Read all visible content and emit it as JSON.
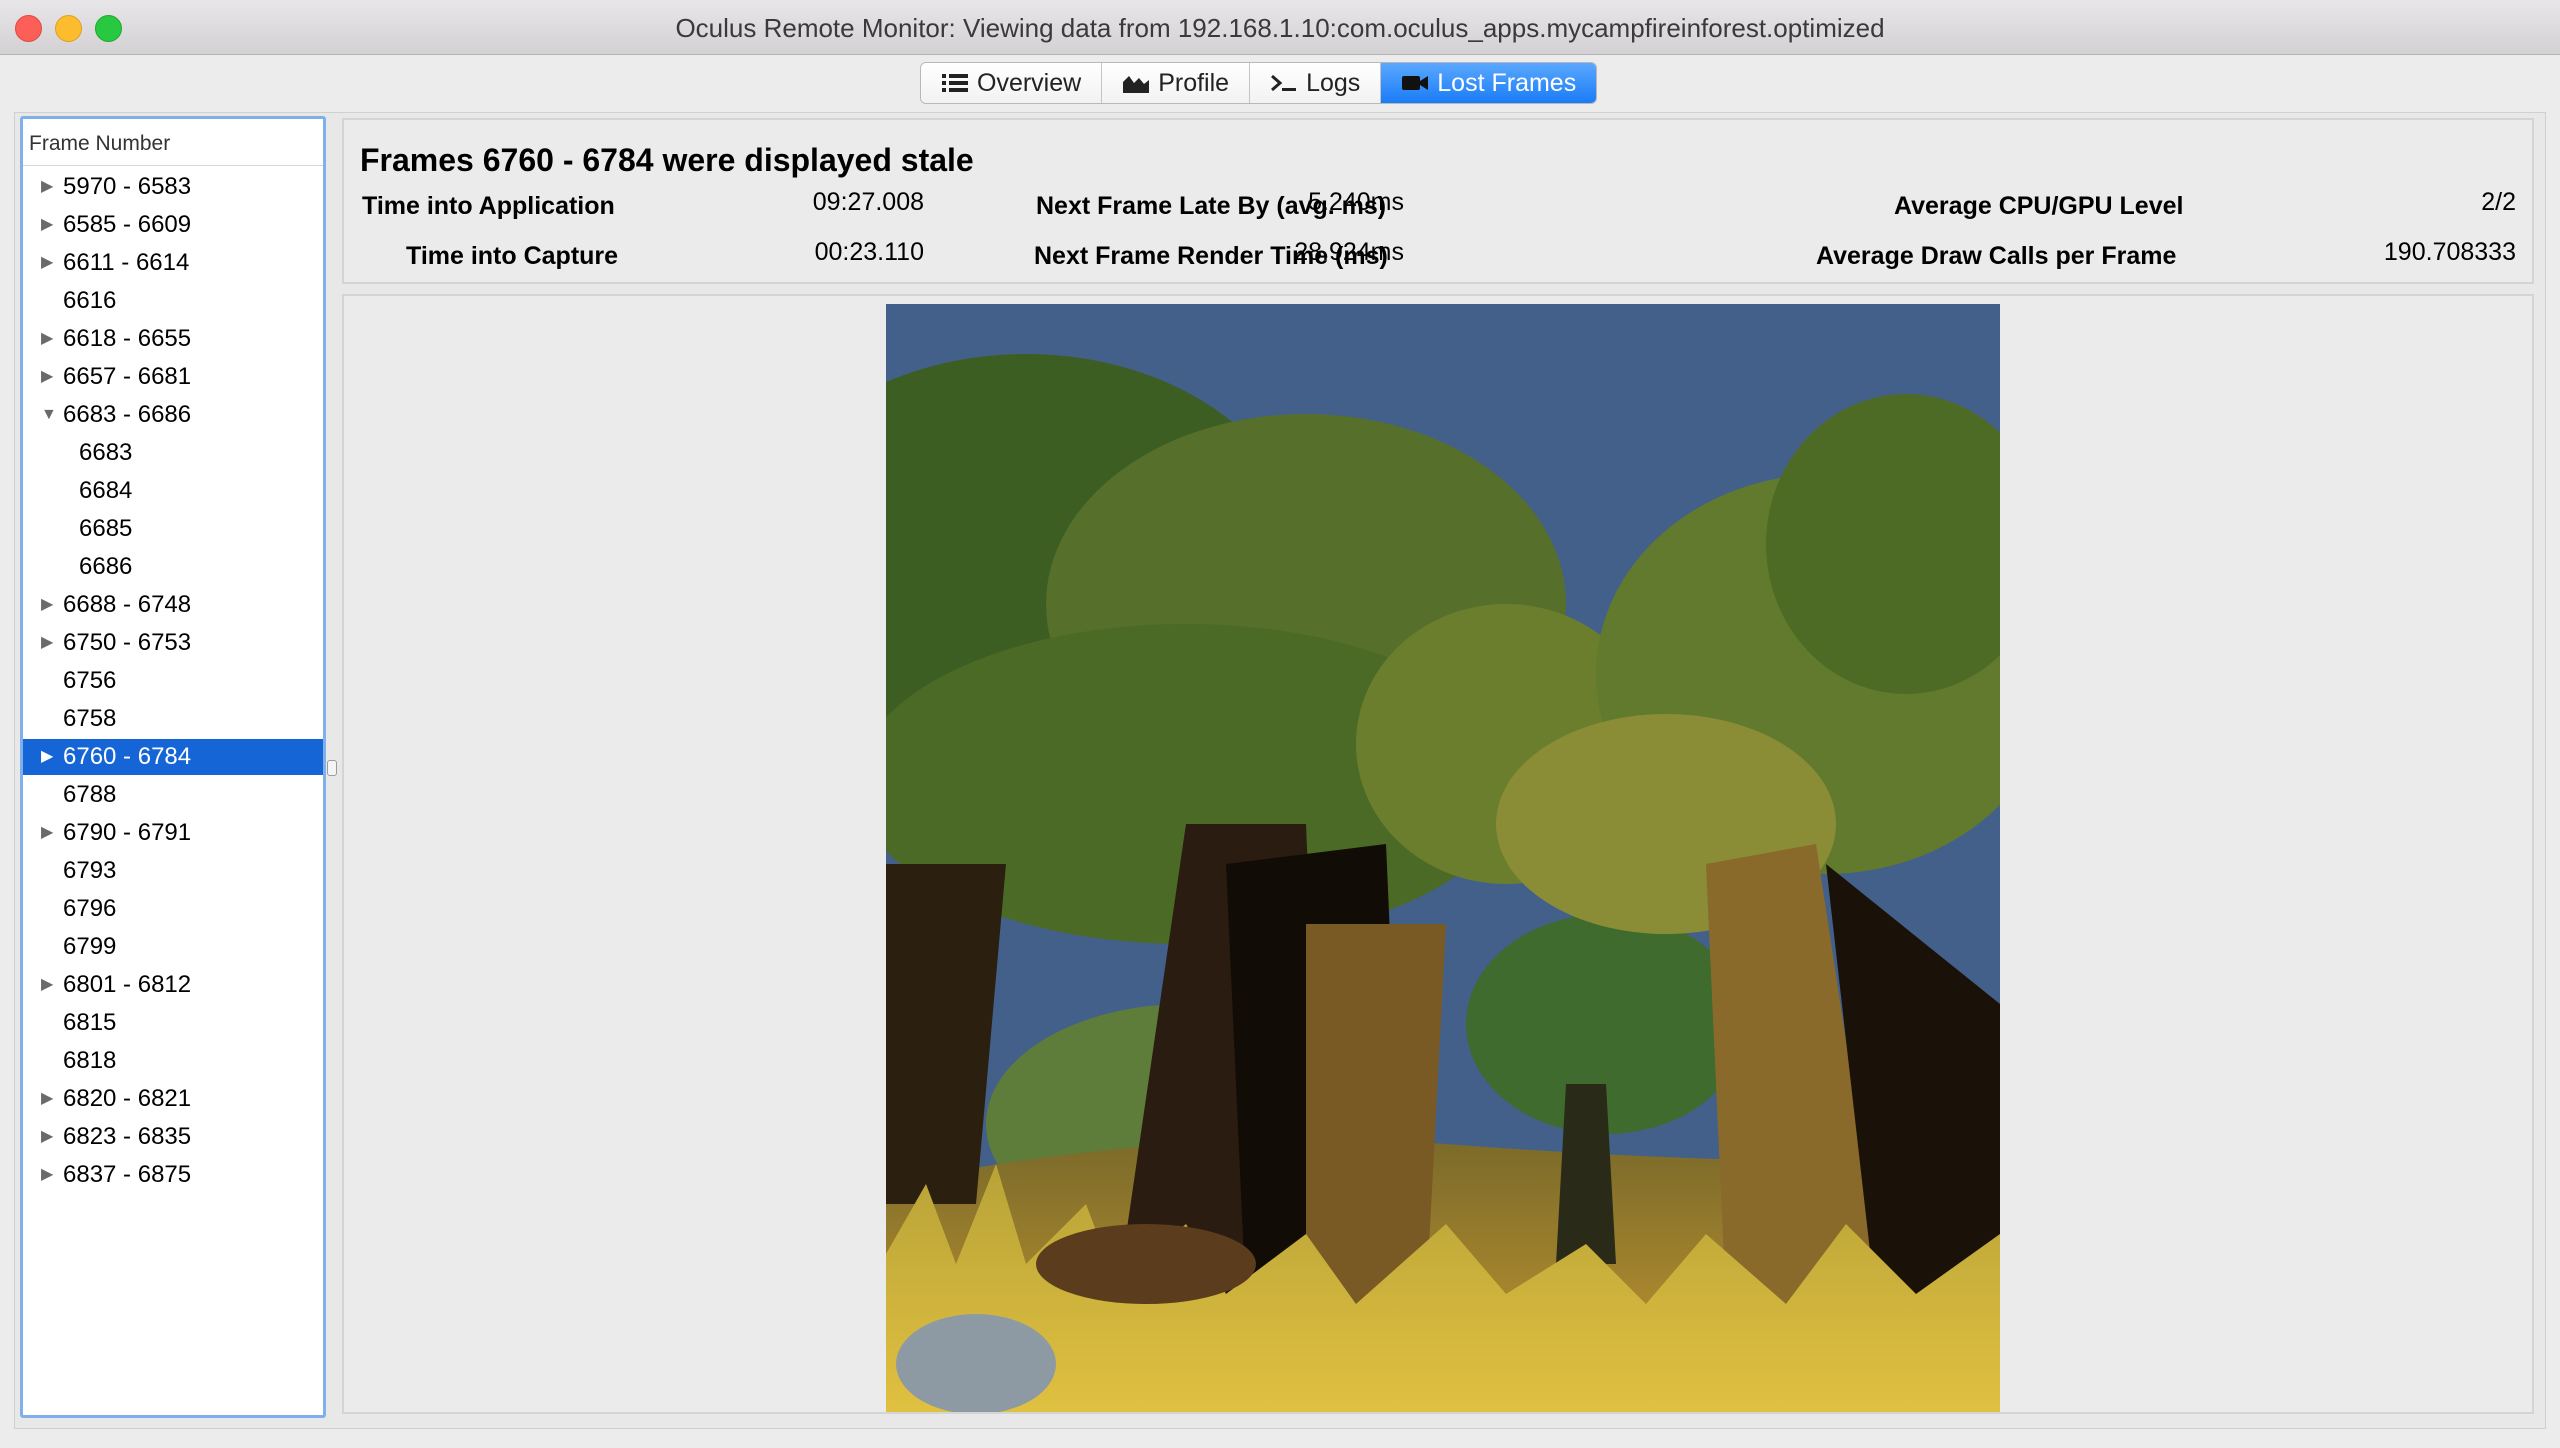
{
  "window": {
    "title": "Oculus Remote Monitor: Viewing data from 192.168.1.10:com.oculus_apps.mycampfireinforest.optimized"
  },
  "tabs": [
    {
      "label": "Overview",
      "icon": "list-icon"
    },
    {
      "label": "Profile",
      "icon": "area-chart-icon"
    },
    {
      "label": "Logs",
      "icon": "terminal-icon"
    },
    {
      "label": "Lost Frames",
      "icon": "camera-icon",
      "active": true
    }
  ],
  "sidebar": {
    "header": "Frame Number",
    "rows": [
      {
        "label": "5970 - 6583",
        "expandable": true
      },
      {
        "label": "6585 - 6609",
        "expandable": true
      },
      {
        "label": "6611 - 6614",
        "expandable": true
      },
      {
        "label": "6616",
        "expandable": false
      },
      {
        "label": "6618 - 6655",
        "expandable": true
      },
      {
        "label": "6657 - 6681",
        "expandable": true
      },
      {
        "label": "6683 - 6686",
        "expandable": true,
        "expanded": true
      },
      {
        "label": "6683",
        "child": true
      },
      {
        "label": "6684",
        "child": true
      },
      {
        "label": "6685",
        "child": true
      },
      {
        "label": "6686",
        "child": true
      },
      {
        "label": "6688 - 6748",
        "expandable": true
      },
      {
        "label": "6750 - 6753",
        "expandable": true
      },
      {
        "label": "6756",
        "expandable": false
      },
      {
        "label": "6758",
        "expandable": false
      },
      {
        "label": "6760 - 6784",
        "expandable": true,
        "selected": true
      },
      {
        "label": "6788",
        "expandable": false
      },
      {
        "label": "6790 - 6791",
        "expandable": true
      },
      {
        "label": "6793",
        "expandable": false
      },
      {
        "label": "6796",
        "expandable": false
      },
      {
        "label": "6799",
        "expandable": false
      },
      {
        "label": "6801 - 6812",
        "expandable": true
      },
      {
        "label": "6815",
        "expandable": false
      },
      {
        "label": "6818",
        "expandable": false
      },
      {
        "label": "6820 - 6821",
        "expandable": true
      },
      {
        "label": "6823 - 6835",
        "expandable": true
      },
      {
        "label": "6837 - 6875",
        "expandable": true
      }
    ]
  },
  "info": {
    "title": "Frames 6760 - 6784 were displayed stale",
    "time_into_application_label": "Time into Application",
    "time_into_application": "09:27.008",
    "time_into_capture_label": "Time into Capture",
    "time_into_capture": "00:23.110",
    "next_frame_late_label": "Next Frame Late By (avg. ms)",
    "next_frame_late": "5.240ms",
    "next_frame_render_label": "Next Frame Render Time (ms)",
    "next_frame_render": "28.924ms",
    "avg_cpu_gpu_label": "Average CPU/GPU Level",
    "avg_cpu_gpu": "2/2",
    "avg_draw_calls_label": "Average Draw Calls per Frame",
    "avg_draw_calls": "190.708333"
  },
  "colors": {
    "selection": "#1665d6",
    "tab_active": "#1a7cf6",
    "sky": "#43608a"
  }
}
